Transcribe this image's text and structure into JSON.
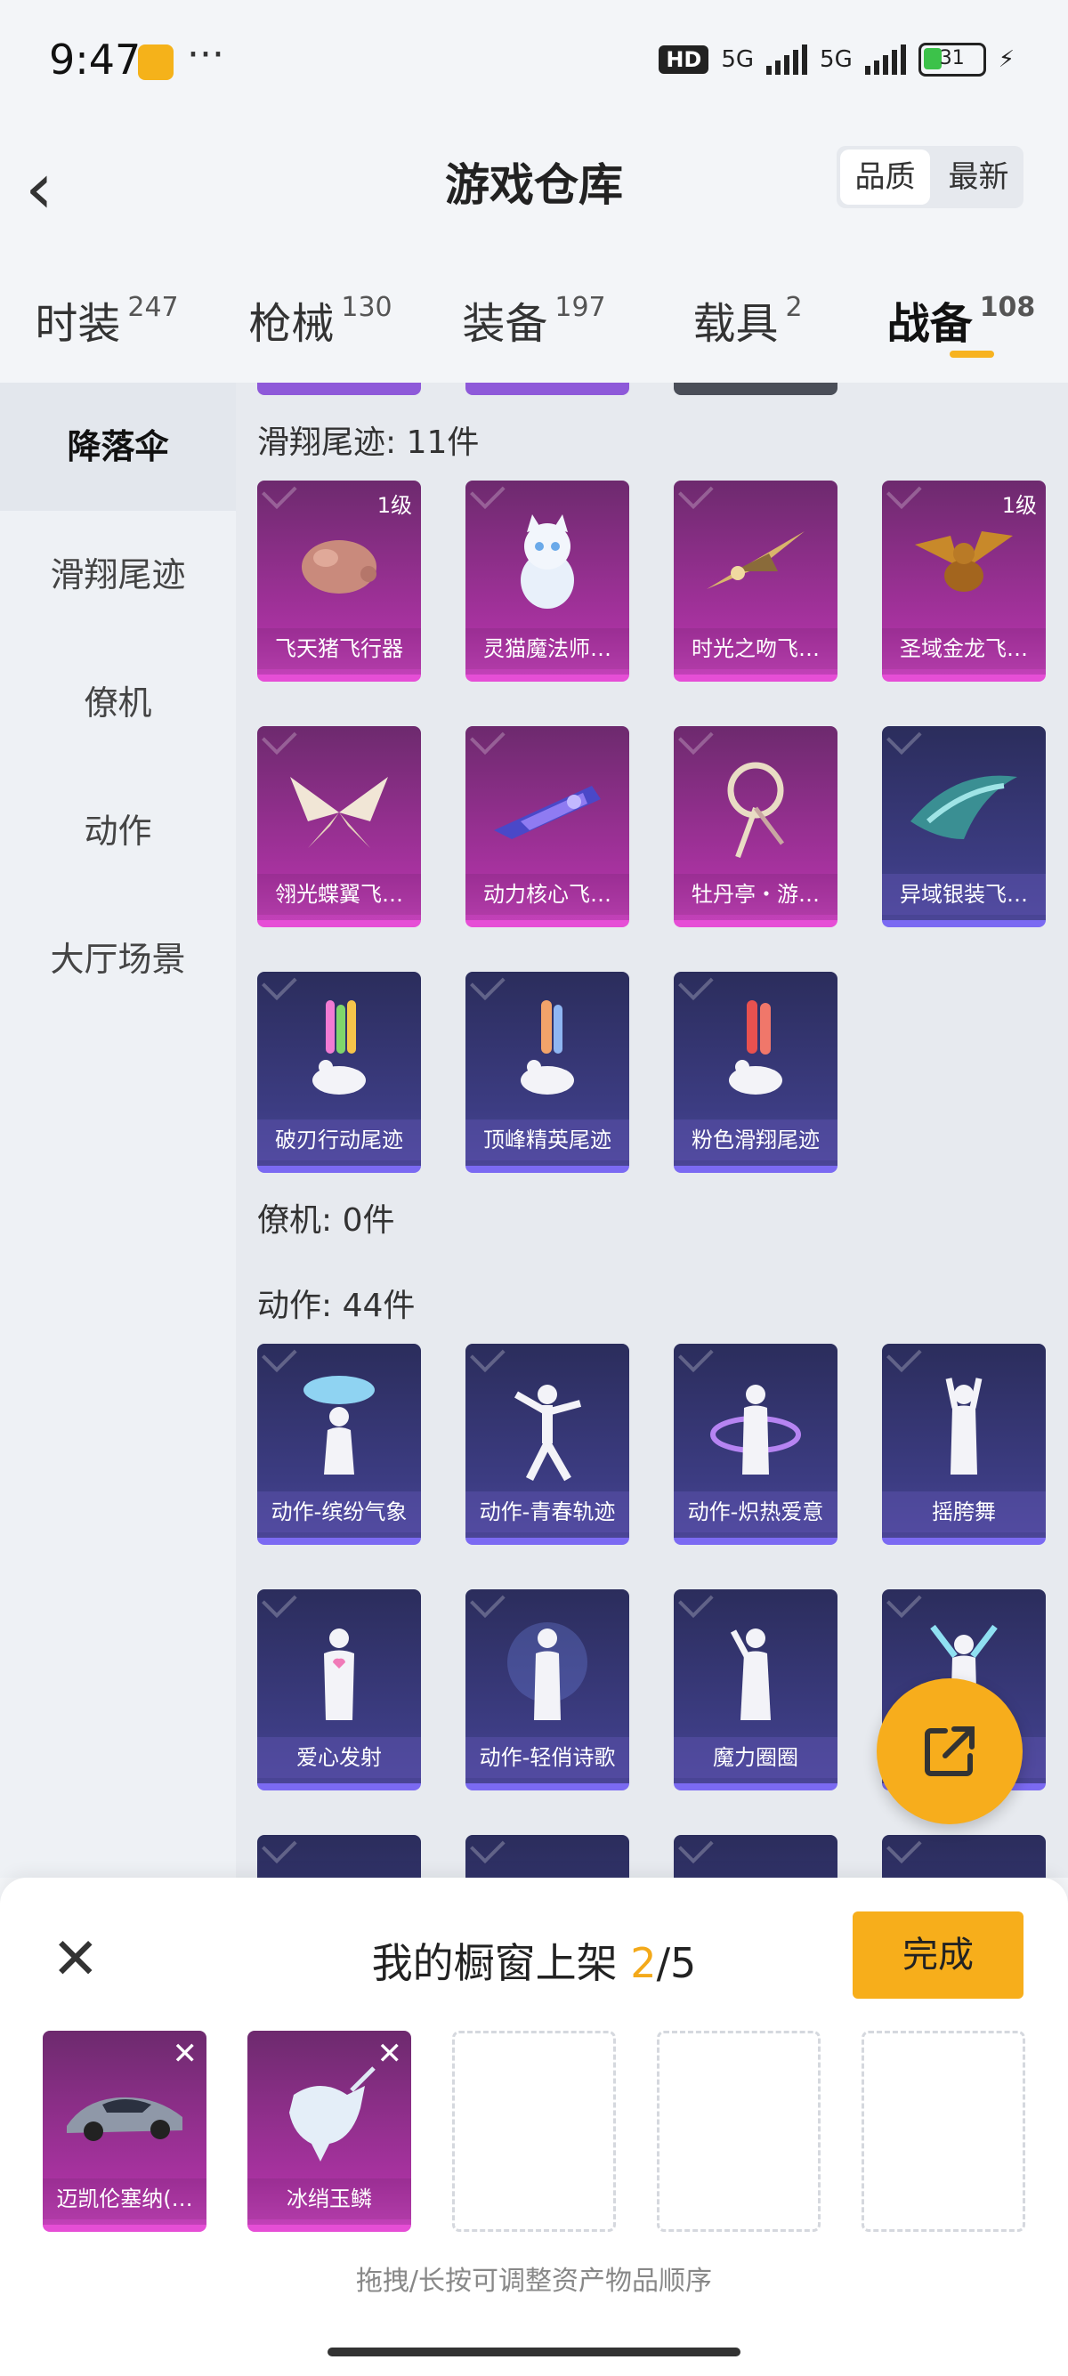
{
  "status_bar": {
    "time": "9:47",
    "dots": "···",
    "hd": "HD",
    "net1": "5G",
    "net2": "5G",
    "battery": "31"
  },
  "header": {
    "title": "游戏仓库",
    "sort_quality": "品质",
    "sort_newest": "最新"
  },
  "tabs": [
    {
      "label": "时装",
      "count": "247"
    },
    {
      "label": "枪械",
      "count": "130"
    },
    {
      "label": "装备",
      "count": "197"
    },
    {
      "label": "载具",
      "count": "2"
    },
    {
      "label": "战备",
      "count": "108"
    }
  ],
  "sidebar": {
    "items": [
      "降落伞",
      "滑翔尾迹",
      "僚机",
      "动作",
      "大厅场景"
    ]
  },
  "sections": {
    "glide": {
      "title": "滑翔尾迹: 11件"
    },
    "wingman": {
      "title": "僚机: 0件"
    },
    "emote": {
      "title": "动作: 44件"
    }
  },
  "glide_items": [
    {
      "label": "飞天猪飞行器",
      "level": "1级"
    },
    {
      "label": "灵猫魔法师…",
      "level": ""
    },
    {
      "label": "时光之吻飞…",
      "level": ""
    },
    {
      "label": "圣域金龙飞…",
      "level": "1级"
    },
    {
      "label": "翎光蝶翼飞…",
      "level": ""
    },
    {
      "label": "动力核心飞…",
      "level": ""
    },
    {
      "label": "牡丹亭・游…",
      "level": ""
    },
    {
      "label": "异域银装飞…",
      "level": ""
    },
    {
      "label": "破刃行动尾迹",
      "level": ""
    },
    {
      "label": "顶峰精英尾迹",
      "level": ""
    },
    {
      "label": "粉色滑翔尾迹",
      "level": ""
    }
  ],
  "emote_items": [
    {
      "label": "动作-缤纷气象"
    },
    {
      "label": "动作-青春轨迹"
    },
    {
      "label": "动作-炽热爱意"
    },
    {
      "label": "摇胯舞"
    },
    {
      "label": "爱心发射"
    },
    {
      "label": "动作-轻俏诗歌"
    },
    {
      "label": "魔力圈圈"
    },
    {
      "label": ""
    }
  ],
  "panel": {
    "title": "我的橱窗上架",
    "current": "2",
    "total": "/5",
    "done": "完成",
    "hint": "拖拽/长按可调整资产物品顺序",
    "slots": [
      {
        "label": "迈凯伦塞纳(…"
      },
      {
        "label": "冰绡玉鳞"
      }
    ]
  },
  "icons": [
    "back-arrow-icon",
    "share-export-icon",
    "close-icon",
    "checkmark-icon"
  ],
  "colors": {
    "accent": "#f7ae1b",
    "purple_rarity": "#b335a8",
    "blue_rarity": "#3d3c85"
  }
}
